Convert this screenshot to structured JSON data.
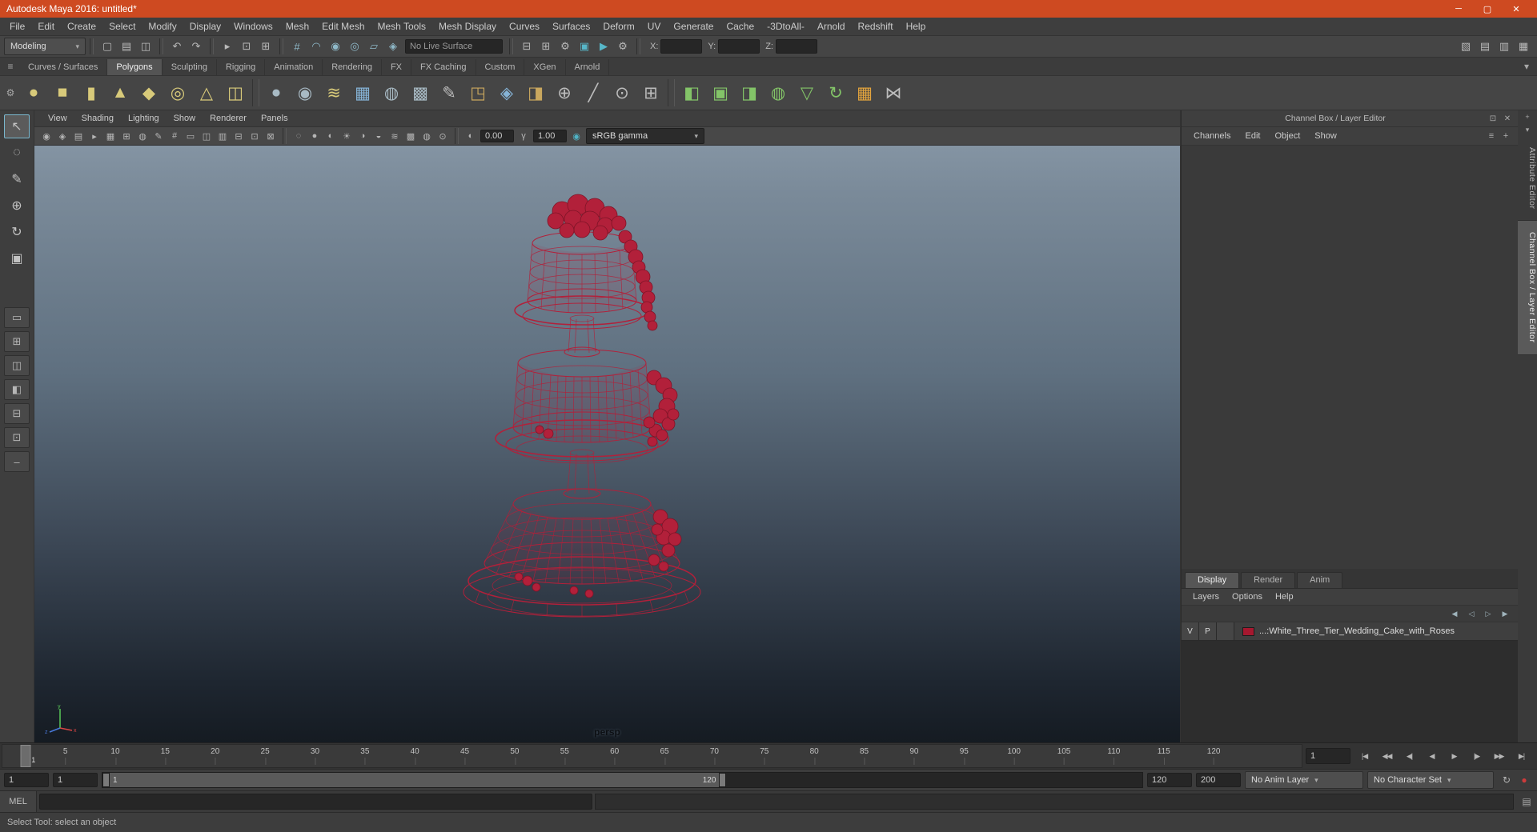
{
  "window": {
    "title": "Autodesk Maya 2016: untitled*",
    "minimize_glyph": "─",
    "maximize_glyph": "▢",
    "close_glyph": "✕"
  },
  "menubar": {
    "items": [
      "File",
      "Edit",
      "Create",
      "Select",
      "Modify",
      "Display",
      "Windows",
      "Mesh",
      "Edit Mesh",
      "Mesh Tools",
      "Mesh Display",
      "Curves",
      "Surfaces",
      "Deform",
      "UV",
      "Generate",
      "Cache",
      "-3DtoAll-",
      "Arnold",
      "Redshift",
      "Help"
    ]
  },
  "statusline": {
    "menuset": "Modeling",
    "file_icons": [
      {
        "name": "new-scene-icon",
        "glyph": "▢"
      },
      {
        "name": "open-scene-icon",
        "glyph": "▤"
      },
      {
        "name": "save-scene-icon",
        "glyph": "◫"
      }
    ],
    "undo_icons": [
      {
        "name": "undo-icon",
        "glyph": "↶"
      },
      {
        "name": "redo-icon",
        "glyph": "↷"
      }
    ],
    "select_icons": [
      {
        "name": "select-hierarchy-icon",
        "glyph": "▸"
      },
      {
        "name": "select-object-icon",
        "glyph": "⊡"
      },
      {
        "name": "select-component-icon",
        "glyph": "⊞"
      }
    ],
    "snap_icons": [
      {
        "name": "snap-grid-icon",
        "glyph": "#",
        "color": "#8fb9c9"
      },
      {
        "name": "snap-curve-icon",
        "glyph": "◠",
        "color": "#8fb9c9"
      },
      {
        "name": "snap-point-icon",
        "glyph": "◉",
        "color": "#8fb9c9"
      },
      {
        "name": "snap-projected-center-icon",
        "glyph": "◎",
        "color": "#8fb9c9"
      },
      {
        "name": "snap-view-plane-icon",
        "glyph": "▱",
        "color": "#8fb9c9"
      },
      {
        "name": "make-live-icon",
        "glyph": "◈",
        "color": "#8fb9c9"
      }
    ],
    "live_surface": "No Live Surface",
    "history_icons": [
      {
        "name": "inputs-icon",
        "glyph": "⊟"
      },
      {
        "name": "outputs-icon",
        "glyph": "⊞"
      },
      {
        "name": "construction-history-icon",
        "glyph": "⚙"
      },
      {
        "name": "render-icon",
        "glyph": "▣",
        "color": "#57b7c9"
      },
      {
        "name": "ipr-render-icon",
        "glyph": "▶",
        "color": "#57b7c9"
      },
      {
        "name": "render-settings-icon",
        "glyph": "⚙"
      }
    ],
    "x_label": "X:",
    "y_label": "Y:",
    "z_label": "Z:",
    "right_icons": [
      {
        "name": "toggle-modeling-toolkit-icon",
        "glyph": "▧"
      },
      {
        "name": "toggle-tool-settings-icon",
        "glyph": "▤"
      },
      {
        "name": "toggle-attribute-editor-icon",
        "glyph": "▥"
      },
      {
        "name": "toggle-channel-box-icon",
        "glyph": "▦"
      }
    ]
  },
  "shelf": {
    "tab_options_glyph": "≡",
    "gear_glyph": "⚙",
    "overflow_glyph": "▾",
    "tabs": [
      {
        "label": "Curves / Surfaces"
      },
      {
        "label": "Polygons",
        "active": true
      },
      {
        "label": "Sculpting"
      },
      {
        "label": "Rigging"
      },
      {
        "label": "Animation"
      },
      {
        "label": "Rendering"
      },
      {
        "label": "FX"
      },
      {
        "label": "FX Caching"
      },
      {
        "label": "Custom"
      },
      {
        "label": "XGen"
      },
      {
        "label": "Arnold"
      }
    ],
    "icons": [
      {
        "name": "poly-sphere-icon",
        "glyph": "●",
        "color": "#d8ca7a"
      },
      {
        "name": "poly-cube-icon",
        "glyph": "■",
        "color": "#d8ca7a"
      },
      {
        "name": "poly-cylinder-icon",
        "glyph": "▮",
        "color": "#d8ca7a"
      },
      {
        "name": "poly-cone-icon",
        "glyph": "▲",
        "color": "#d8ca7a"
      },
      {
        "name": "poly-platonic-icon",
        "glyph": "◆",
        "color": "#d8ca7a"
      },
      {
        "name": "poly-torus-icon",
        "glyph": "◎",
        "color": "#d8ca7a"
      },
      {
        "name": "poly-pyramid-icon",
        "glyph": "△",
        "color": "#d8ca7a"
      },
      {
        "name": "poly-pipe-icon",
        "glyph": "◫",
        "color": "#d8ca7a"
      },
      {
        "sep": true
      },
      {
        "name": "smooth-mesh-icon",
        "glyph": "●",
        "color": "#a8bac4"
      },
      {
        "name": "subdiv-sphere-icon",
        "glyph": "◉",
        "color": "#a8bac4"
      },
      {
        "name": "poly-text-icon",
        "glyph": "≋",
        "color": "#d8ca7a"
      },
      {
        "name": "sweep-mesh-icon",
        "glyph": "▦",
        "color": "#85b3d6"
      },
      {
        "name": "remesh-icon",
        "glyph": "◍",
        "color": "#a8bac4"
      },
      {
        "name": "retopologize-icon",
        "glyph": "▩",
        "color": "#a8bac4"
      },
      {
        "name": "pencil-curve-icon",
        "glyph": "✎",
        "color": "#bcbcbc"
      },
      {
        "name": "extrude-icon",
        "glyph": "◳",
        "color": "#c9a75e"
      },
      {
        "name": "bevel-icon",
        "glyph": "◈",
        "color": "#85b3d6"
      },
      {
        "name": "bridge-icon",
        "glyph": "◨",
        "color": "#c9a75e"
      },
      {
        "name": "boolean-icon",
        "glyph": "⊕",
        "color": "#bcbcbc"
      },
      {
        "name": "multi-cut-icon",
        "glyph": "╱",
        "color": "#bcbcbc"
      },
      {
        "name": "target-weld-icon",
        "glyph": "⊙",
        "color": "#bcbcbc"
      },
      {
        "name": "quad-draw-icon",
        "glyph": "⊞",
        "color": "#bcbcbc"
      },
      {
        "sep": true
      },
      {
        "name": "mirror-icon",
        "glyph": "◧",
        "color": "#83c468"
      },
      {
        "name": "combine-icon",
        "glyph": "▣",
        "color": "#83c468"
      },
      {
        "name": "separate-icon",
        "glyph": "◨",
        "color": "#83c468"
      },
      {
        "name": "smooth-icon",
        "glyph": "◍",
        "color": "#83c468"
      },
      {
        "name": "reduce-icon",
        "glyph": "▽",
        "color": "#83c468"
      },
      {
        "name": "spin-edge-icon",
        "glyph": "↻",
        "color": "#83c468"
      },
      {
        "name": "checker-map-icon",
        "glyph": "▦",
        "color": "#e3a43d"
      },
      {
        "name": "transfer-attributes-icon",
        "glyph": "⋈",
        "color": "#bcbcbc"
      }
    ]
  },
  "toolbox": {
    "tools": [
      {
        "name": "select-tool",
        "glyph": "↖",
        "active": true
      },
      {
        "name": "lasso-tool",
        "glyph": "◌"
      },
      {
        "name": "paint-select-tool",
        "glyph": "✎"
      },
      {
        "name": "move-tool",
        "glyph": "⊕"
      },
      {
        "name": "rotate-tool",
        "glyph": "↻"
      },
      {
        "name": "scale-tool",
        "glyph": "▣"
      }
    ],
    "layouts": [
      {
        "name": "single-pane-layout-button",
        "glyph": "▭"
      },
      {
        "name": "four-pane-layout-button",
        "glyph": "⊞"
      },
      {
        "name": "two-pane-layout-button",
        "glyph": "◫"
      },
      {
        "name": "persp-outliner-layout-button",
        "glyph": "◧"
      },
      {
        "name": "hypershade-layout-button",
        "glyph": "⊟"
      },
      {
        "name": "uv-editor-layout-button",
        "glyph": "⊡"
      },
      {
        "name": "shrink-layout-button",
        "glyph": "–"
      }
    ]
  },
  "viewport": {
    "menus": [
      "View",
      "Shading",
      "Lighting",
      "Show",
      "Renderer",
      "Panels"
    ],
    "bar_icons_a": [
      {
        "name": "select-camera-icon",
        "glyph": "◉"
      },
      {
        "name": "lock-camera-icon",
        "glyph": "◈"
      },
      {
        "name": "camera-attributes-icon",
        "glyph": "▤"
      },
      {
        "name": "bookmarks-icon",
        "glyph": "▸"
      },
      {
        "name": "image-plane-icon",
        "glyph": "▦"
      },
      {
        "name": "2d-pan-zoom-icon",
        "glyph": "⊞"
      },
      {
        "name": "oversample-icon",
        "glyph": "◍"
      },
      {
        "name": "grease-pencil-icon",
        "glyph": "✎"
      },
      {
        "name": "grid-toggle-icon",
        "glyph": "#"
      },
      {
        "name": "film-gate-icon",
        "glyph": "▭"
      },
      {
        "name": "resolution-gate-icon",
        "glyph": "◫"
      },
      {
        "name": "gate-mask-icon",
        "glyph": "▥"
      },
      {
        "name": "field-chart-icon",
        "glyph": "⊟"
      },
      {
        "name": "safe-action-icon",
        "gly­ph": "⊡",
        "glyph": "⊡"
      },
      {
        "name": "safe-title-icon",
        "glyph": "⊠"
      }
    ],
    "bar_icons_b": [
      {
        "name": "wireframe-icon",
        "glyph": "◌"
      },
      {
        "name": "shaded-icon",
        "glyph": "●"
      },
      {
        "name": "textured-icon",
        "glyph": "◐"
      },
      {
        "name": "use-all-lights-icon",
        "glyph": "☀"
      },
      {
        "name": "shadows-icon",
        "glyph": "◑"
      },
      {
        "name": "ao-icon",
        "glyph": "◒"
      },
      {
        "name": "motion-blur-icon",
        "glyph": "≋"
      },
      {
        "name": "multisample-icon",
        "glyph": "▩"
      },
      {
        "name": "xray-icon",
        "glyph": "◍"
      },
      {
        "name": "isolate-select-icon",
        "glyph": "⊙"
      }
    ],
    "exposure_icon": "◐",
    "exposure": "0.00",
    "gamma_icon": "γ",
    "gamma": "1.00",
    "colorspace_icon": "◉",
    "colorspace": "sRGB gamma",
    "camera": "persp",
    "wire_color": "#b2203a",
    "axis": {
      "x": "x",
      "y": "y",
      "z": "z"
    }
  },
  "channelbox": {
    "title": "Channel Box / Layer Editor",
    "popout_glyph": "⊡",
    "close_glyph": "✕",
    "menus": [
      "Channels",
      "Edit",
      "Object",
      "Show"
    ],
    "mini_icons": [
      {
        "name": "channel-settings-icon",
        "glyph": "≡"
      },
      {
        "name": "manipulator-icon",
        "glyph": "+"
      }
    ],
    "layer_tabs": [
      {
        "label": "Display",
        "active": true
      },
      {
        "label": "Render"
      },
      {
        "label": "Anim"
      }
    ],
    "layer_menus": [
      "Layers",
      "Options",
      "Help"
    ],
    "layer_icons": [
      {
        "name": "layer-solo-icon",
        "glyph": "◀"
      },
      {
        "name": "layer-mute-icon",
        "glyph": "◁"
      },
      {
        "name": "layer-empty-icon",
        "glyph": "▷"
      },
      {
        "name": "layer-new-icon",
        "glyph": "▶"
      }
    ],
    "layer_row": {
      "visible": "V",
      "playback": "P",
      "swatch_color": "#a5182f",
      "name": "...:White_Three_Tier_Wedding_Cake_with_Roses"
    }
  },
  "side_strip": {
    "icons": [
      {
        "name": "panel-pin-icon",
        "glyph": "+"
      },
      {
        "name": "panel-menu-icon",
        "glyph": "▾"
      }
    ],
    "tabs": [
      {
        "label": "Attribute Editor"
      },
      {
        "label": "Channel Box / Layer Editor",
        "active": true
      }
    ]
  },
  "timeline": {
    "ticks": [
      "5",
      "10",
      "15",
      "20",
      "25",
      "30",
      "35",
      "40",
      "45",
      "50",
      "55",
      "60",
      "65",
      "70",
      "75",
      "80",
      "85",
      "90",
      "95",
      "100",
      "105",
      "110",
      "115",
      "120"
    ],
    "current_frame": "1",
    "current_frame_field": "1",
    "playback": [
      {
        "name": "go-to-start-button",
        "glyph": "|◀"
      },
      {
        "name": "step-back-key-button",
        "glyph": "◀◀"
      },
      {
        "name": "step-back-frame-button",
        "glyph": "◀|"
      },
      {
        "name": "play-backwards-button",
        "glyph": "◀"
      },
      {
        "name": "play-forwards-button",
        "glyph": "▶"
      },
      {
        "name": "step-forward-frame-button",
        "glyph": "|▶"
      },
      {
        "name": "step-forward-key-button",
        "glyph": "▶▶"
      },
      {
        "name": "go-to-end-button",
        "glyph": "▶|"
      }
    ]
  },
  "rangebar": {
    "animation_start": "1",
    "playback_start": "1",
    "bar_start_label": "1",
    "bar_end_label": "120",
    "playback_end": "120",
    "animation_end": "200",
    "anim_layer": "No Anim Layer",
    "character_set": "No Character Set",
    "arrow": "▾",
    "icons": [
      {
        "name": "playback-options-icon",
        "glyph": "↻"
      },
      {
        "name": "auto-key-icon",
        "glyph": "●",
        "color": "#cc3b3b"
      }
    ]
  },
  "command_line": {
    "label": "MEL"
  },
  "help_line": {
    "text": "Select Tool: select an object"
  }
}
